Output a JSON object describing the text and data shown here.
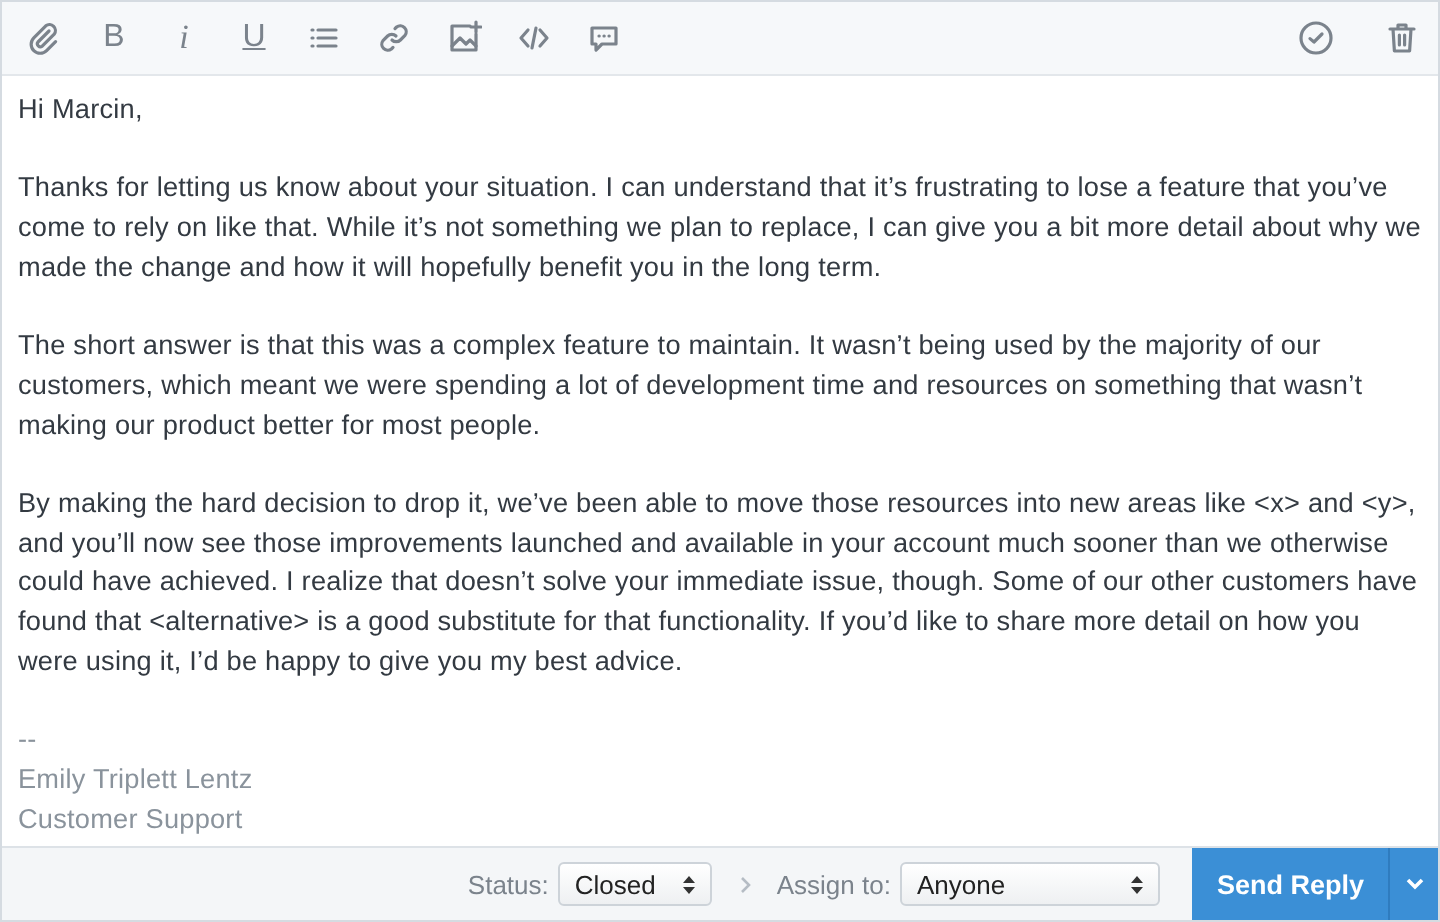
{
  "toolbar": {
    "left": [
      {
        "kind": "attach"
      },
      {
        "kind": "bold",
        "text": "B"
      },
      {
        "kind": "italic",
        "text": "i"
      },
      {
        "kind": "underline",
        "text": "U"
      },
      {
        "kind": "list"
      },
      {
        "kind": "link"
      },
      {
        "kind": "image"
      },
      {
        "kind": "code"
      },
      {
        "kind": "comment"
      }
    ],
    "right": [
      {
        "kind": "check"
      },
      {
        "kind": "trash"
      }
    ]
  },
  "message": {
    "greeting": "Hi Marcin,",
    "paragraphs": [
      "Thanks for letting us know about your situation. I can understand that it’s frustrating to lose a feature that you’ve come to rely on like that. While it’s not something we plan to replace, I can give you a bit more detail about why we made the change and how it will hopefully benefit you in the long term.",
      "The short answer is that this was a complex feature to maintain. It wasn’t being used by the majority of our customers, which meant we were spending a lot of development time and resources on something that wasn’t making our product better for most people.",
      "By making the hard decision to drop it, we’ve been able to move those resources into new areas like <x> and <y>, and you’ll now see those improvements launched and available in your account much sooner than we otherwise could have achieved. I realize that doesn’t solve your immediate issue, though. Some of our other customers have found that <alternative> is a good substitute for that functionality. If you’d like to share more detail on how you were using it, I’d be happy to give you my best advice."
    ],
    "signature": [
      "--",
      "Emily Triplett Lentz",
      "Customer Support"
    ]
  },
  "footer": {
    "status_label": "Status:",
    "status_value": "Closed",
    "assign_label": "Assign to:",
    "assign_value": "Anyone",
    "send_button": "Send Reply"
  }
}
